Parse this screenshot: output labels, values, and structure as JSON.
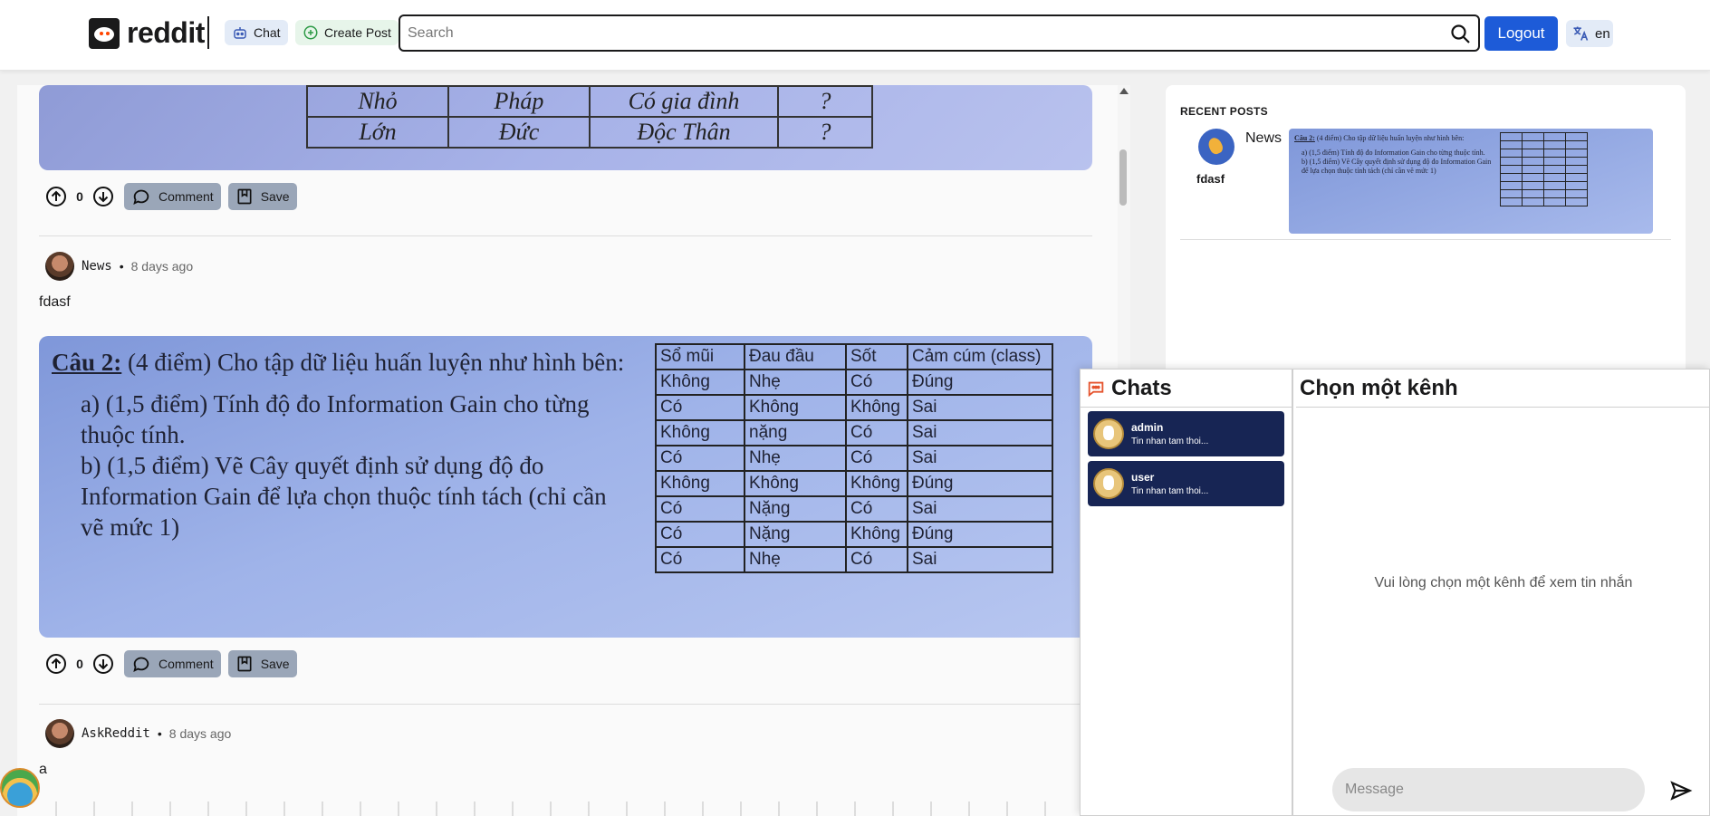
{
  "header": {
    "logo_text": "reddit",
    "chat_label": "Chat",
    "create_post_label": "Create Post",
    "search_placeholder": "Search",
    "logout_label": "Logout",
    "language_label": "en"
  },
  "feed": {
    "top_image_table": [
      [
        "Nhỏ",
        "Pháp",
        "Có gia đình",
        "?"
      ],
      [
        "Lớn",
        "Đức",
        "Độc Thân",
        "?"
      ]
    ],
    "posts": [
      {
        "votes": "0",
        "comment_label": "Comment",
        "save_label": "Save"
      },
      {
        "subreddit": "News",
        "time": "8 days ago",
        "title": "fdasf",
        "image": {
          "question_heading": "Câu 2:",
          "question_intro": "(4 điểm) Cho tập dữ liệu huấn luyện như hình bên:",
          "part_a": "a) (1,5 điểm) Tính độ đo Information Gain cho từng thuộc tính.",
          "part_b": "b) (1,5 điểm) Vẽ Cây quyết định sử dụng độ đo Information Gain để lựa chọn thuộc tính tách (chỉ cần vẽ mức 1)",
          "table_header": [
            "Sổ mũi",
            "Đau đầu",
            "Sốt",
            "Cảm cúm (class)"
          ],
          "table_rows": [
            [
              "Không",
              "Nhẹ",
              "Có",
              "Đúng"
            ],
            [
              "Có",
              "Không",
              "Không",
              "Sai"
            ],
            [
              "Không",
              "nặng",
              "Có",
              "Sai"
            ],
            [
              "Có",
              "Nhẹ",
              "Có",
              "Sai"
            ],
            [
              "Không",
              "Không",
              "Không",
              "Đúng"
            ],
            [
              "Có",
              "Nặng",
              "Có",
              "Sai"
            ],
            [
              "Có",
              "Nặng",
              "Không",
              "Đúng"
            ],
            [
              "Có",
              "Nhẹ",
              "Có",
              "Sai"
            ]
          ]
        },
        "votes": "0",
        "comment_label": "Comment",
        "save_label": "Save"
      },
      {
        "subreddit": "AskReddit",
        "time": "8 days ago",
        "title": "a"
      }
    ],
    "separator": "•"
  },
  "sidebar": {
    "recent_posts_title": "RECENT POSTS",
    "recent": {
      "subreddit": "News",
      "user": "fdasf"
    }
  },
  "chat": {
    "title": "Chats",
    "channels": [
      {
        "name": "admin",
        "last": "Tin nhan tam thoi..."
      },
      {
        "name": "user",
        "last": "Tin nhan tam thoi..."
      }
    ],
    "main_title": "Chọn một kênh",
    "empty_text": "Vui lòng chọn một kênh để xem tin nhắn",
    "message_placeholder": "Message"
  },
  "colors": {
    "primary": "#1d5bd8",
    "channel_bg": "#172554",
    "action_bg": "#9aa6b8"
  }
}
